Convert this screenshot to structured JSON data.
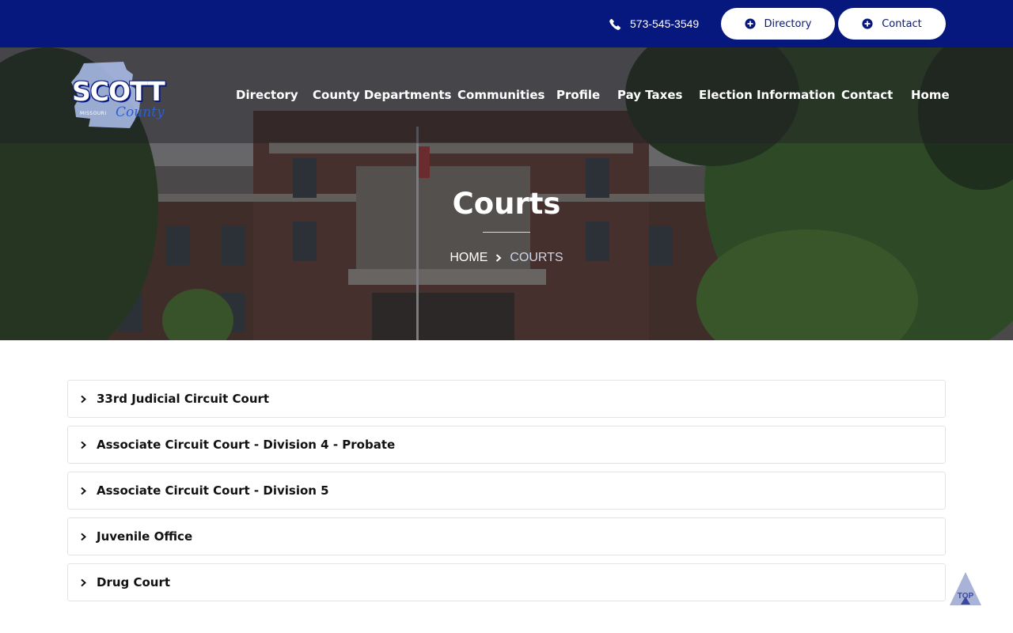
{
  "topbar": {
    "phone": "573-545-3549",
    "directory_label": "Directory",
    "contact_label": "Contact"
  },
  "logo": {
    "main_text": "SCOTT",
    "sub_text": "County",
    "state_text": "MISSOURI"
  },
  "nav": {
    "items": [
      {
        "label": "Directory"
      },
      {
        "label": "County Departments"
      },
      {
        "label": "Communities"
      },
      {
        "label": "Profile"
      },
      {
        "label": "Pay Taxes"
      },
      {
        "label": "Election Information"
      },
      {
        "label": "Contact"
      },
      {
        "label": "Home"
      }
    ]
  },
  "hero": {
    "title": "Courts",
    "breadcrumb_home": "HOME",
    "breadcrumb_current": "COURTS"
  },
  "accordion": {
    "items": [
      {
        "label": "33rd Judicial Circuit Court"
      },
      {
        "label": "Associate Circuit Court - Division 4 - Probate"
      },
      {
        "label": "Associate Circuit Court - Division 5"
      },
      {
        "label": "Juvenile Office"
      },
      {
        "label": "Drug Court"
      }
    ]
  },
  "to_top": {
    "label": "TOP"
  },
  "colors": {
    "brand_blue": "#06177e",
    "logo_blue": "#2d5fd1"
  },
  "icons": {
    "phone": "phone-icon",
    "plus_circle": "plus-circle-icon",
    "chevron": "chevron-right-icon",
    "to_top": "triangle-up-icon"
  }
}
